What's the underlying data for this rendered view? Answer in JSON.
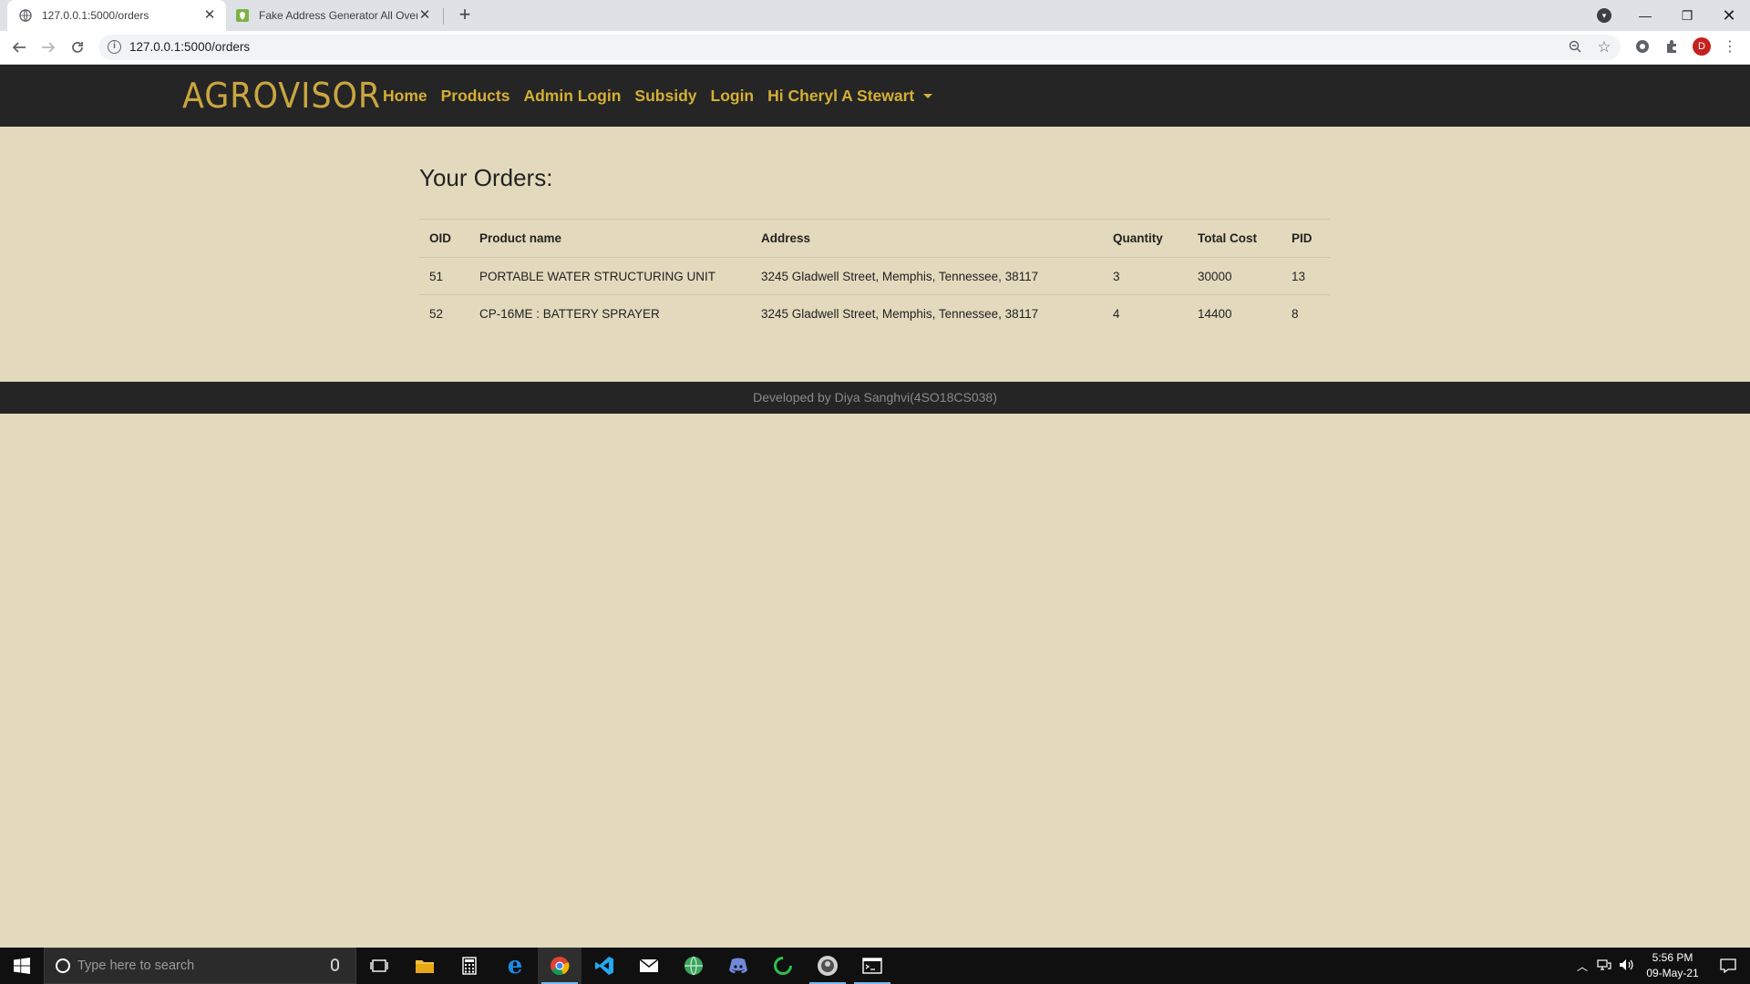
{
  "browser": {
    "tabs": [
      {
        "title": "127.0.0.1:5000/orders",
        "active": true
      },
      {
        "title": "Fake Address Generator All Over",
        "active": false
      }
    ],
    "url": "127.0.0.1:5000/orders",
    "profile_initial": "D"
  },
  "site": {
    "logo": "AGROVISOR",
    "nav": [
      "Home",
      "Products",
      "Admin Login",
      "Subsidy",
      "Login"
    ],
    "user_menu": "Hi Cheryl A Stewart"
  },
  "orders": {
    "title": "Your Orders:",
    "columns": [
      "OID",
      "Product name",
      "Address",
      "Quantity",
      "Total Cost",
      "PID"
    ],
    "rows": [
      [
        "51",
        "PORTABLE WATER STRUCTURING UNIT",
        "3245 Gladwell Street, Memphis, Tennessee, 38117",
        "3",
        "30000",
        "13"
      ],
      [
        "52",
        "CP-16ME : BATTERY SPRAYER",
        "3245 Gladwell Street, Memphis, Tennessee, 38117",
        "4",
        "14400",
        "8"
      ]
    ]
  },
  "footer": {
    "text": "Developed by Diya Sanghvi(4SO18CS038)"
  },
  "taskbar": {
    "search_placeholder": "Type here to search",
    "time": "5:56 PM",
    "date": "09-May-21"
  },
  "colors": {
    "page_bg": "#e3dabd",
    "navbar_bg": "#252525",
    "accent_gold": "#d4af37"
  }
}
